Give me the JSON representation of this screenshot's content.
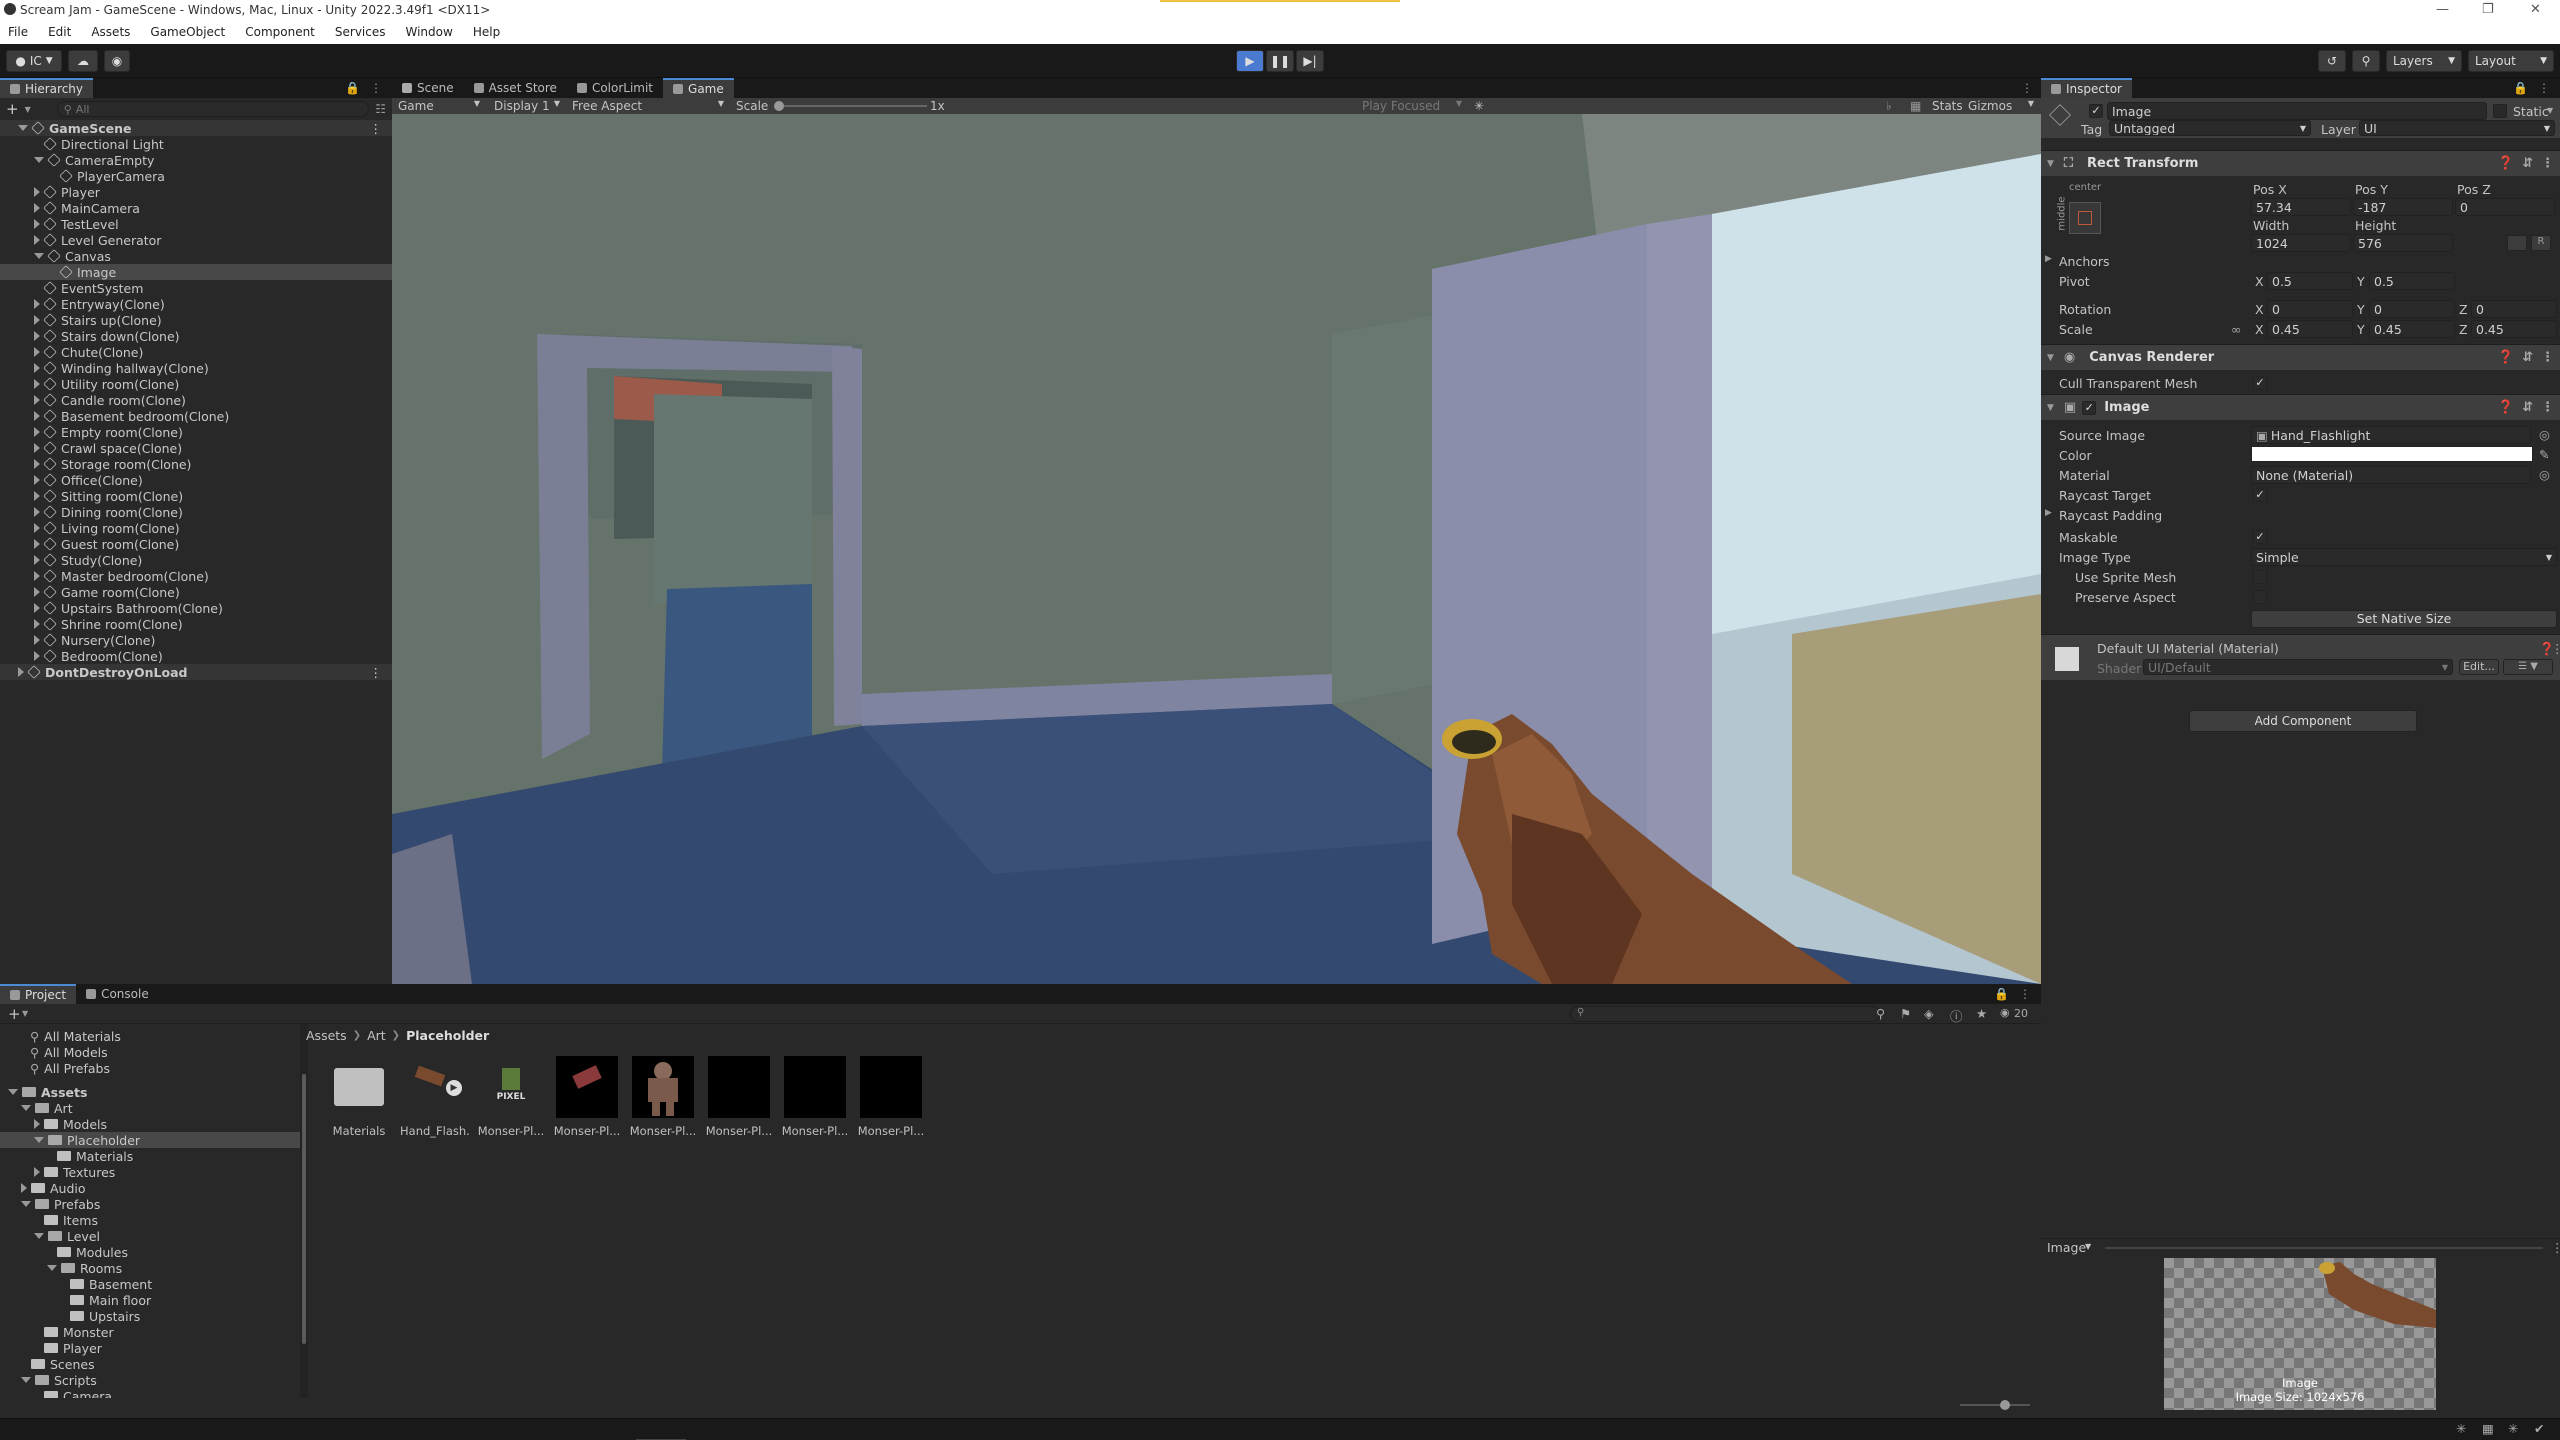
{
  "window": {
    "title": "Scream Jam - GameScene - Windows, Mac, Linux - Unity 2022.3.49f1 <DX11>",
    "menu": [
      "File",
      "Edit",
      "Assets",
      "GameObject",
      "Component",
      "Services",
      "Window",
      "Help"
    ]
  },
  "toolbar": {
    "account": "IC",
    "layers": "Layers",
    "layout": "Layout"
  },
  "hierarchy": {
    "tab": "Hierarchy",
    "search_placeholder": "All",
    "items": [
      {
        "label": "GameScene",
        "depth": 0,
        "expand": "open",
        "type": "scene"
      },
      {
        "label": "Directional Light",
        "depth": 1,
        "expand": "none"
      },
      {
        "label": "CameraEmpty",
        "depth": 1,
        "expand": "open"
      },
      {
        "label": "PlayerCamera",
        "depth": 2,
        "expand": "none"
      },
      {
        "label": "Player",
        "depth": 1,
        "expand": "closed"
      },
      {
        "label": "MainCamera",
        "depth": 1,
        "expand": "closed"
      },
      {
        "label": "TestLevel",
        "depth": 1,
        "expand": "closed"
      },
      {
        "label": "Level Generator",
        "depth": 1,
        "expand": "closed"
      },
      {
        "label": "Canvas",
        "depth": 1,
        "expand": "open"
      },
      {
        "label": "Image",
        "depth": 2,
        "expand": "none",
        "selected": true
      },
      {
        "label": "EventSystem",
        "depth": 1,
        "expand": "none"
      },
      {
        "label": "Entryway(Clone)",
        "depth": 1,
        "expand": "closed"
      },
      {
        "label": "Stairs up(Clone)",
        "depth": 1,
        "expand": "closed"
      },
      {
        "label": "Stairs down(Clone)",
        "depth": 1,
        "expand": "closed"
      },
      {
        "label": "Chute(Clone)",
        "depth": 1,
        "expand": "closed"
      },
      {
        "label": "Winding hallway(Clone)",
        "depth": 1,
        "expand": "closed"
      },
      {
        "label": "Utility room(Clone)",
        "depth": 1,
        "expand": "closed"
      },
      {
        "label": "Candle room(Clone)",
        "depth": 1,
        "expand": "closed"
      },
      {
        "label": "Basement bedroom(Clone)",
        "depth": 1,
        "expand": "closed"
      },
      {
        "label": "Empty room(Clone)",
        "depth": 1,
        "expand": "closed"
      },
      {
        "label": "Crawl space(Clone)",
        "depth": 1,
        "expand": "closed"
      },
      {
        "label": "Storage room(Clone)",
        "depth": 1,
        "expand": "closed"
      },
      {
        "label": "Office(Clone)",
        "depth": 1,
        "expand": "closed"
      },
      {
        "label": "Sitting room(Clone)",
        "depth": 1,
        "expand": "closed"
      },
      {
        "label": "Dining room(Clone)",
        "depth": 1,
        "expand": "closed"
      },
      {
        "label": "Living room(Clone)",
        "depth": 1,
        "expand": "closed"
      },
      {
        "label": "Guest room(Clone)",
        "depth": 1,
        "expand": "closed"
      },
      {
        "label": "Study(Clone)",
        "depth": 1,
        "expand": "closed"
      },
      {
        "label": "Master bedroom(Clone)",
        "depth": 1,
        "expand": "closed"
      },
      {
        "label": "Game room(Clone)",
        "depth": 1,
        "expand": "closed"
      },
      {
        "label": "Upstairs Bathroom(Clone)",
        "depth": 1,
        "expand": "closed"
      },
      {
        "label": "Shrine room(Clone)",
        "depth": 1,
        "expand": "closed"
      },
      {
        "label": "Nursery(Clone)",
        "depth": 1,
        "expand": "closed"
      },
      {
        "label": "Bedroom(Clone)",
        "depth": 1,
        "expand": "closed"
      },
      {
        "label": "DontDestroyOnLoad",
        "depth": 0,
        "expand": "closed",
        "type": "scene"
      }
    ]
  },
  "view_tabs": [
    "Scene",
    "Asset Store",
    "ColorLimit",
    "Game"
  ],
  "game_toolbar": {
    "display_mode": "Game",
    "display": "Display 1",
    "aspect": "Free Aspect",
    "scale_label": "Scale",
    "scale_value": "1x",
    "play_focused": "Play Focused",
    "stats": "Stats",
    "gizmos": "Gizmos"
  },
  "inspector": {
    "tab": "Inspector",
    "object_name": "Image",
    "static_label": "Static",
    "tag_label": "Tag",
    "tag_value": "Untagged",
    "layer_label": "Layer",
    "layer_value": "UI",
    "rect_transform": {
      "title": "Rect Transform",
      "anchor_h": "center",
      "anchor_v": "middle",
      "pos_x_label": "Pos X",
      "pos_x": "57.34",
      "pos_y_label": "Pos Y",
      "pos_y": "-187",
      "pos_z_label": "Pos Z",
      "pos_z": "0",
      "width_label": "Width",
      "width": "1024",
      "height_label": "Height",
      "height": "576",
      "anchors": "Anchors",
      "pivot": "Pivot",
      "pivot_x": "0.5",
      "pivot_y": "0.5",
      "rotation": "Rotation",
      "rot_x": "0",
      "rot_y": "0",
      "rot_z": "0",
      "scale": "Scale",
      "scale_x": "0.45",
      "scale_y": "0.45",
      "scale_z": "0.45",
      "axis_x": "X",
      "axis_y": "Y",
      "axis_z": "Z",
      "blueprint_btn": "R"
    },
    "canvas_renderer": {
      "title": "Canvas Renderer",
      "cull_label": "Cull Transparent Mesh"
    },
    "image": {
      "title": "Image",
      "source_label": "Source Image",
      "source_value": "Hand_Flashlight",
      "color_label": "Color",
      "material_label": "Material",
      "material_value": "None (Material)",
      "raycast_label": "Raycast Target",
      "raycast_padding": "Raycast Padding",
      "maskable_label": "Maskable",
      "type_label": "Image Type",
      "type_value": "Simple",
      "sprite_mesh": "Use Sprite Mesh",
      "preserve": "Preserve Aspect",
      "native_btn": "Set Native Size"
    },
    "material": {
      "title": "Default UI Material (Material)",
      "shader_label": "Shader",
      "shader_value": "UI/Default",
      "edit_btn": "Edit..."
    },
    "add_component": "Add Component",
    "preview": {
      "title": "Image",
      "label": "Image",
      "size": "Image Size: 1024x576"
    }
  },
  "project": {
    "tabs": [
      "Project",
      "Console"
    ],
    "favorites": [
      "All Materials",
      "All Models",
      "All Prefabs"
    ],
    "tree": [
      {
        "label": "Assets",
        "depth": 0,
        "expand": "open",
        "bold": true
      },
      {
        "label": "Art",
        "depth": 1,
        "expand": "open"
      },
      {
        "label": "Models",
        "depth": 2,
        "expand": "closed"
      },
      {
        "label": "Placeholder",
        "depth": 2,
        "expand": "open",
        "selected": true
      },
      {
        "label": "Materials",
        "depth": 3,
        "expand": "none"
      },
      {
        "label": "Textures",
        "depth": 2,
        "expand": "closed"
      },
      {
        "label": "Audio",
        "depth": 1,
        "expand": "closed"
      },
      {
        "label": "Prefabs",
        "depth": 1,
        "expand": "open"
      },
      {
        "label": "Items",
        "depth": 2,
        "expand": "none"
      },
      {
        "label": "Level",
        "depth": 2,
        "expand": "open"
      },
      {
        "label": "Modules",
        "depth": 3,
        "expand": "none"
      },
      {
        "label": "Rooms",
        "depth": 3,
        "expand": "open"
      },
      {
        "label": "Basement",
        "depth": 4,
        "expand": "none"
      },
      {
        "label": "Main floor",
        "depth": 4,
        "expand": "none"
      },
      {
        "label": "Upstairs",
        "depth": 4,
        "expand": "none"
      },
      {
        "label": "Monster",
        "depth": 2,
        "expand": "none"
      },
      {
        "label": "Player",
        "depth": 2,
        "expand": "none"
      },
      {
        "label": "Scenes",
        "depth": 1,
        "expand": "none"
      },
      {
        "label": "Scripts",
        "depth": 1,
        "expand": "open"
      },
      {
        "label": "Camera",
        "depth": 2,
        "expand": "none"
      }
    ],
    "breadcrumb": [
      "Assets",
      "Art",
      "Placeholder"
    ],
    "hidden_count": "20",
    "assets": [
      {
        "label": "Materials",
        "kind": "folder"
      },
      {
        "label": "Hand_Flash...",
        "kind": "hand-play"
      },
      {
        "label": "Monser-Pl...",
        "kind": "pixel"
      },
      {
        "label": "Monser-Pl...",
        "kind": "claw"
      },
      {
        "label": "Monser-Pl...",
        "kind": "monster"
      },
      {
        "label": "Monser-Pl...",
        "kind": "black"
      },
      {
        "label": "Monser-Pl...",
        "kind": "black"
      },
      {
        "label": "Monser-Pl...",
        "kind": "black"
      }
    ],
    "pixel_label": "PIXEL"
  },
  "colors": {
    "accent": "#4b8bd6",
    "selected_row": "#2c5d87",
    "panel": "#282828"
  }
}
